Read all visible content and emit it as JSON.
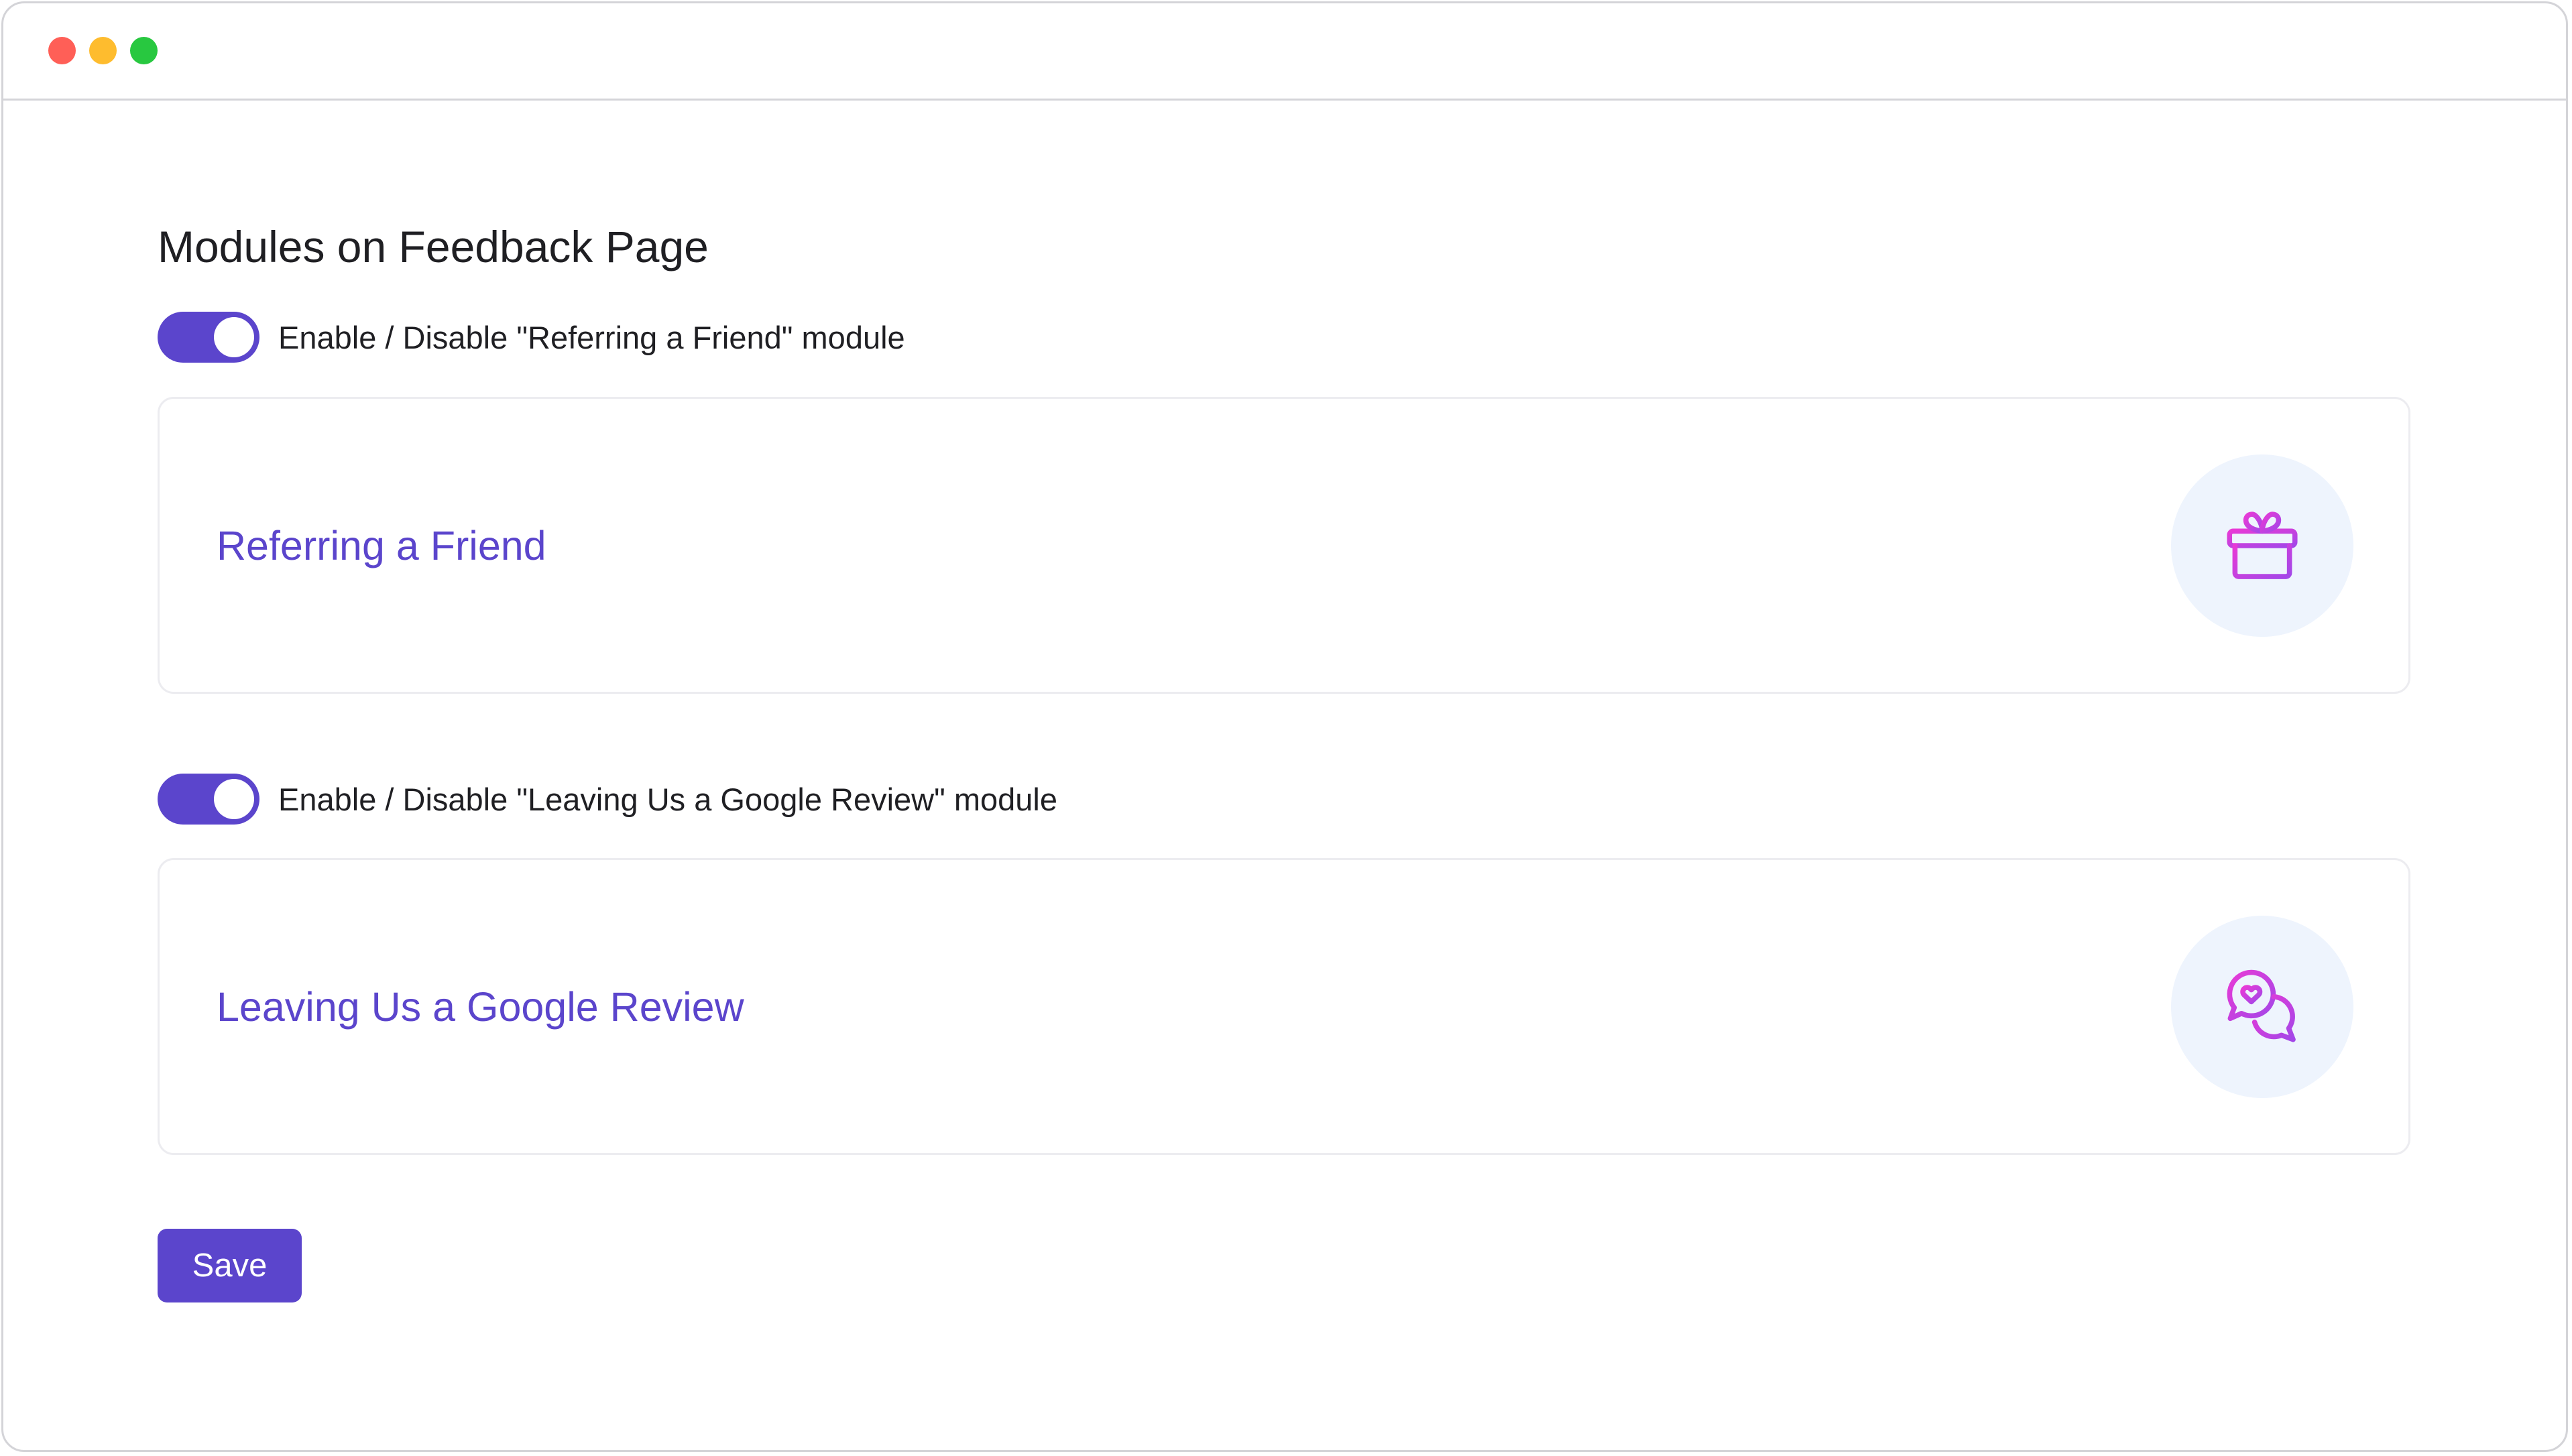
{
  "window": {
    "traffic_lights": {
      "close_color": "#ff5f57",
      "minimize_color": "#febc2e",
      "maximize_color": "#28c840"
    }
  },
  "page": {
    "title": "Modules on Feedback Page"
  },
  "modules": [
    {
      "toggle_label": "Enable / Disable \"Referring a Friend\" module",
      "enabled": true,
      "card_title": "Referring a Friend",
      "icon": "gift-icon"
    },
    {
      "toggle_label": "Enable / Disable \"Leaving Us a Google Review\" module",
      "enabled": true,
      "card_title": "Leaving Us a Google Review",
      "icon": "chat-heart-icon"
    }
  ],
  "actions": {
    "save_label": "Save"
  },
  "colors": {
    "accent": "#5b45cc",
    "card_title": "#5b45cc",
    "icon_gradient_start": "#e83ad6",
    "icon_gradient_end": "#a347e8",
    "icon_circle_bg": "#eef4fd"
  }
}
